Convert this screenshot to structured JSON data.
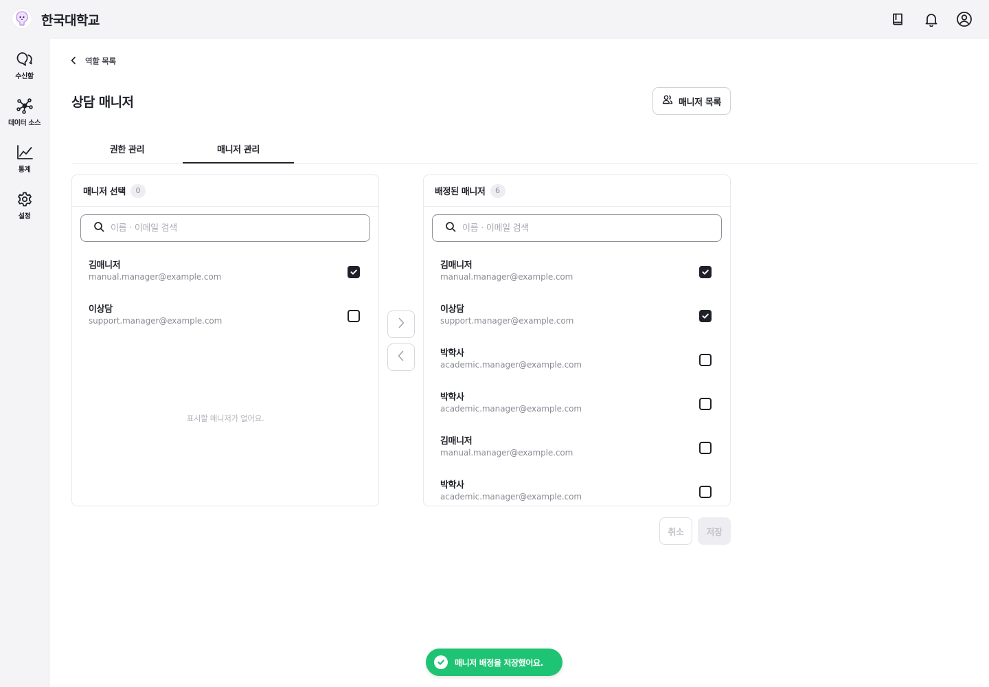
{
  "header": {
    "org_name": "한국대학교",
    "logo_icon": "mascot-logo-icon",
    "icons": [
      "book-icon",
      "bell-icon",
      "user-circle-icon"
    ]
  },
  "sidebar": {
    "items": [
      {
        "label": "수신함",
        "icon": "chat-bubbles-icon"
      },
      {
        "label": "데이터 소스",
        "icon": "network-nodes-icon"
      },
      {
        "label": "통계",
        "icon": "line-chart-icon"
      },
      {
        "label": "설정",
        "icon": "gear-icon"
      }
    ]
  },
  "breadcrumb": {
    "back_label": "역할 목록"
  },
  "page": {
    "title": "상담 매니저",
    "manager_list_button": "매니저 목록"
  },
  "tabs": [
    {
      "label": "권한 관리",
      "active": false
    },
    {
      "label": "매니저 관리",
      "active": true
    }
  ],
  "left_panel": {
    "title": "매니저 선택",
    "count": "0",
    "search_placeholder": "이름 · 이메일 검색",
    "rows": [
      {
        "name": "김매니저",
        "email": "manual.manager@example.com",
        "checked": true
      },
      {
        "name": "이상담",
        "email": "support.manager@example.com",
        "checked": false
      }
    ],
    "empty_text": "표시할 매니저가 없어요."
  },
  "right_panel": {
    "title": "배정된 매니저",
    "count": "6",
    "search_placeholder": "이름 · 이메일 검색",
    "rows": [
      {
        "name": "김매니저",
        "email": "manual.manager@example.com",
        "checked": true
      },
      {
        "name": "이상담",
        "email": "support.manager@example.com",
        "checked": true
      },
      {
        "name": "박학사",
        "email": "academic.manager@example.com",
        "checked": false
      },
      {
        "name": "박학사",
        "email": "academic.manager@example.com",
        "checked": false
      },
      {
        "name": "김매니저",
        "email": "manual.manager@example.com",
        "checked": false
      },
      {
        "name": "박학사",
        "email": "academic.manager@example.com",
        "checked": false
      }
    ]
  },
  "transfer": {
    "right_icon": "chevron-right-icon",
    "left_icon": "chevron-left-icon"
  },
  "actions": {
    "cancel": "취소",
    "save": "저장"
  },
  "toast": {
    "message": "매니저 배정을 저장했어요.",
    "color": "#1ec373"
  },
  "colors": {
    "primary_dark": "#1f2128",
    "muted": "#8a8c96",
    "success": "#1ec373"
  }
}
